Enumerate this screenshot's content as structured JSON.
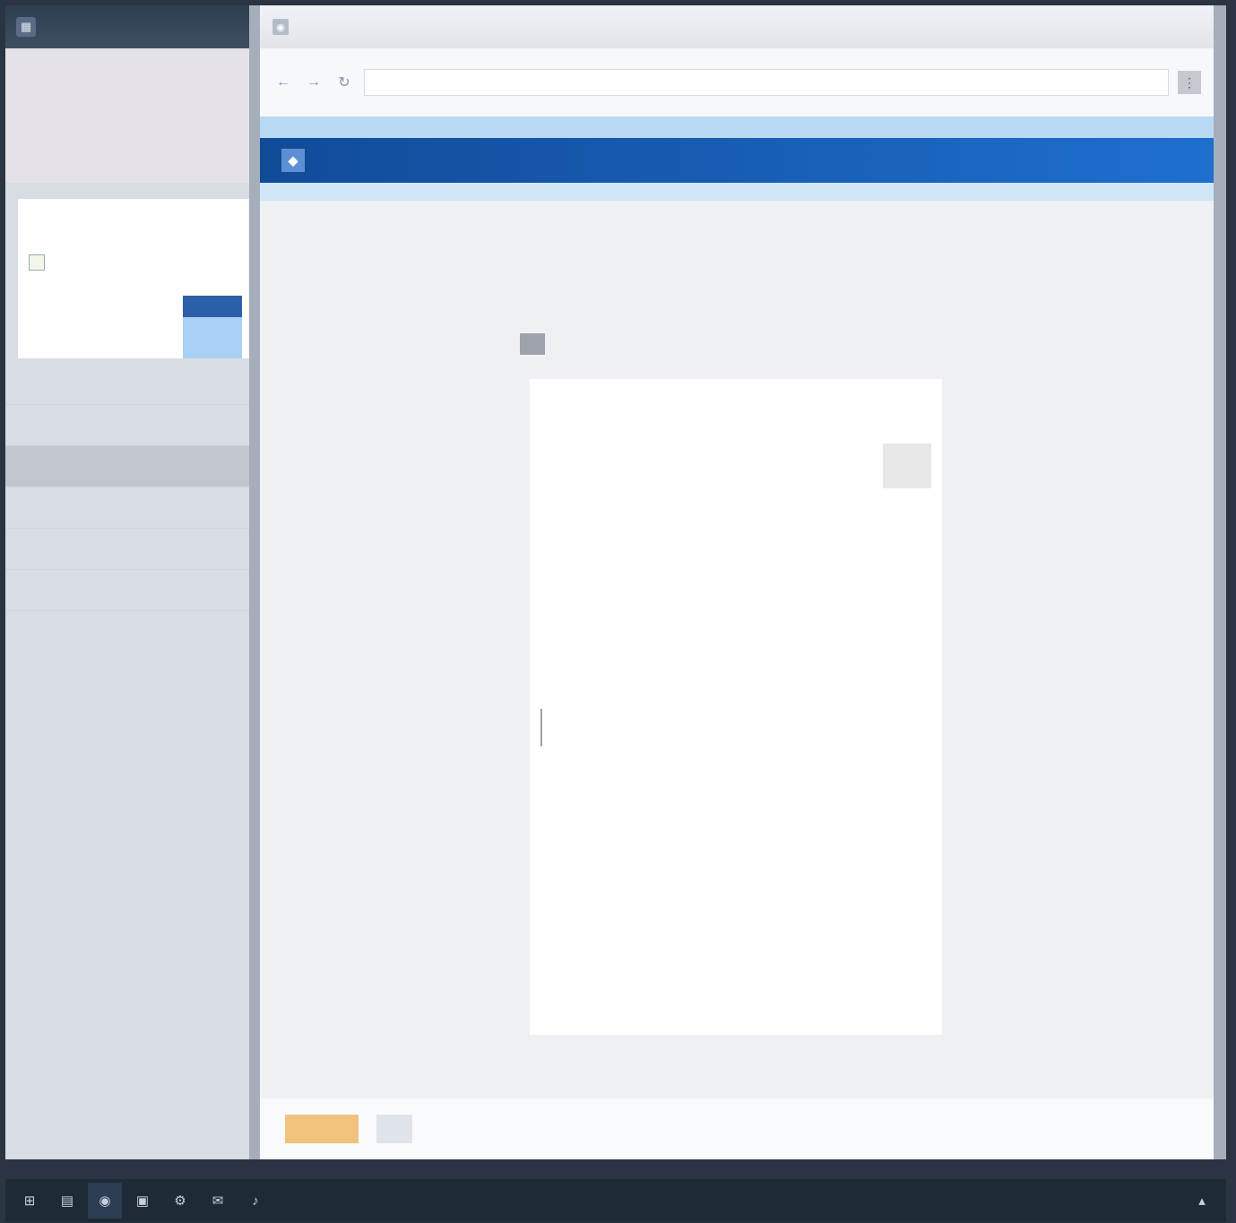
{
  "sidebar": {
    "topbar_title": "",
    "header_lines": [
      "",
      ""
    ],
    "card": {
      "label": "",
      "checkbox_label": "",
      "button_label": ""
    },
    "items": [
      {
        "label": ""
      },
      {
        "label": ""
      },
      {
        "label": ""
      },
      {
        "label": ""
      },
      {
        "label": ""
      },
      {
        "label": ""
      }
    ]
  },
  "window": {
    "title": "",
    "address": {
      "value": "",
      "placeholder": ""
    },
    "site_name": "",
    "page_heading": "",
    "page_subheading": ""
  },
  "form": {
    "step": "",
    "title": "",
    "section_label": "",
    "action_label": "",
    "fields": [
      {
        "label": "",
        "value": ""
      },
      {
        "label": "",
        "value": ""
      },
      {
        "label": "",
        "value": ""
      },
      {
        "label": "",
        "value": ""
      },
      {
        "label": "",
        "value": ""
      },
      {
        "label": "",
        "value": ""
      }
    ]
  },
  "footer": {
    "primary_label": "",
    "secondary_label": ""
  },
  "taskbar": {
    "apps": [
      {
        "icon": "start-icon"
      },
      {
        "icon": "folder-icon"
      },
      {
        "icon": "browser-icon"
      },
      {
        "icon": "terminal-icon"
      },
      {
        "icon": "settings-icon"
      },
      {
        "icon": "mail-icon"
      },
      {
        "icon": "music-icon"
      }
    ]
  },
  "colors": {
    "brand_bar": "#114b98",
    "primary_button": "#f0c27e",
    "sidebar_button": "#2d5fa8"
  }
}
